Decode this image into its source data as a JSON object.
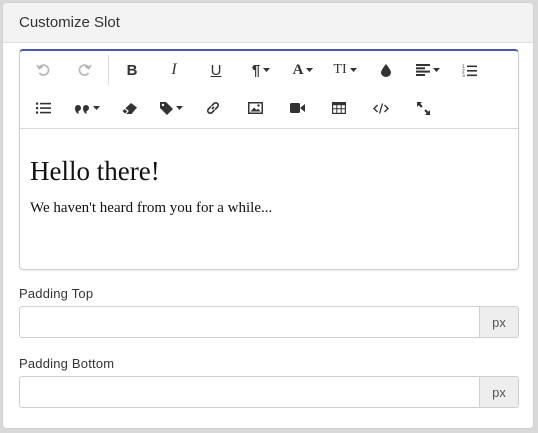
{
  "panel": {
    "title": "Customize Slot"
  },
  "editor": {
    "toolbar": [
      {
        "name": "undo-icon",
        "disabled": true
      },
      {
        "name": "redo-icon",
        "disabled": true
      },
      {
        "name": "bold-icon",
        "glyph": "B"
      },
      {
        "name": "italic-icon",
        "glyph": "I"
      },
      {
        "name": "underline-icon",
        "glyph": "U"
      },
      {
        "name": "paragraph-icon",
        "glyph": "¶"
      },
      {
        "name": "font-color-icon",
        "glyph": "A"
      },
      {
        "name": "font-size-icon",
        "glyph": "TI"
      },
      {
        "name": "color-drop-icon"
      },
      {
        "name": "align-icon"
      },
      {
        "name": "ordered-list-icon"
      },
      {
        "name": "unordered-list-icon"
      },
      {
        "name": "quote-icon"
      },
      {
        "name": "eraser-icon"
      },
      {
        "name": "tag-icon"
      },
      {
        "name": "link-icon"
      },
      {
        "name": "image-icon"
      },
      {
        "name": "video-icon"
      },
      {
        "name": "table-icon"
      },
      {
        "name": "code-icon"
      },
      {
        "name": "fullscreen-icon"
      }
    ],
    "heading": "Hello there!",
    "paragraph": "We haven't heard from you for a while..."
  },
  "padding_top": {
    "label": "Padding Top",
    "value": "",
    "unit": "px"
  },
  "padding_bottom": {
    "label": "Padding Bottom",
    "value": "",
    "unit": "px"
  },
  "colors": {
    "accent": "#4b5aa8",
    "header_bg": "#f3f3f3",
    "addon_bg": "#eeeeee"
  }
}
